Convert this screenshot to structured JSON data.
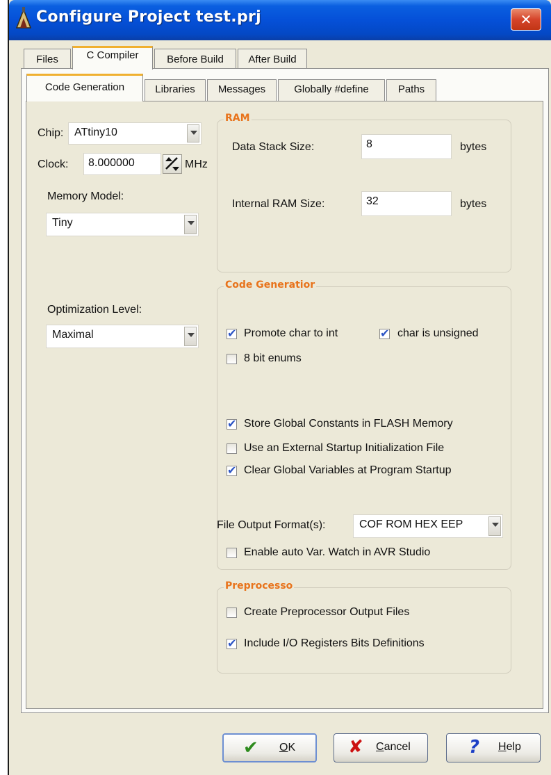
{
  "window": {
    "title": "Configure Project test.prj",
    "close_glyph": "✕"
  },
  "tabs_top": [
    {
      "label": "Files"
    },
    {
      "label": "C Compiler"
    },
    {
      "label": "Before Build"
    },
    {
      "label": "After Build"
    }
  ],
  "tabs_sub": [
    {
      "label": "Code Generation"
    },
    {
      "label": "Libraries"
    },
    {
      "label": "Messages"
    },
    {
      "label": "Globally #define"
    },
    {
      "label": "Paths"
    }
  ],
  "left": {
    "chip_label": "Chip:",
    "chip_value": "ATtiny10",
    "clock_label": "Clock:",
    "clock_value": "8.000000",
    "clock_unit": "MHz",
    "memory_model_label": "Memory Model:",
    "memory_model_value": "Tiny",
    "optimization_label": "Optimization Level:",
    "optimization_value": "Maximal"
  },
  "ram": {
    "title": "RAM",
    "data_stack_label": "Data Stack Size:",
    "data_stack_value": "8",
    "data_stack_unit": "bytes",
    "internal_ram_label": "Internal RAM Size:",
    "internal_ram_value": "32",
    "internal_ram_unit": "bytes"
  },
  "codegen": {
    "title": "Code Generatior",
    "promote_char": "Promote char to int",
    "char_unsigned": "char is unsigned",
    "bit8_enums": "8 bit enums",
    "store_global_const": "Store Global Constants in FLASH Memory",
    "external_startup": "Use an External Startup Initialization File",
    "clear_globals": "Clear Global Variables at Program Startup",
    "file_output_label": "File Output Format(s):",
    "file_output_value": "COF ROM HEX EEP",
    "auto_var_watch": "Enable auto Var. Watch in AVR Studio"
  },
  "preproc": {
    "title": "Preprocesso",
    "create_output": "Create Preprocessor Output Files",
    "include_io": "Include I/O Registers Bits Definitions"
  },
  "buttons": {
    "ok_hotkey": "O",
    "ok_rest": "K",
    "cancel_hotkey": "C",
    "cancel_rest": "ancel",
    "help_hotkey": "H",
    "help_rest": "elp"
  }
}
